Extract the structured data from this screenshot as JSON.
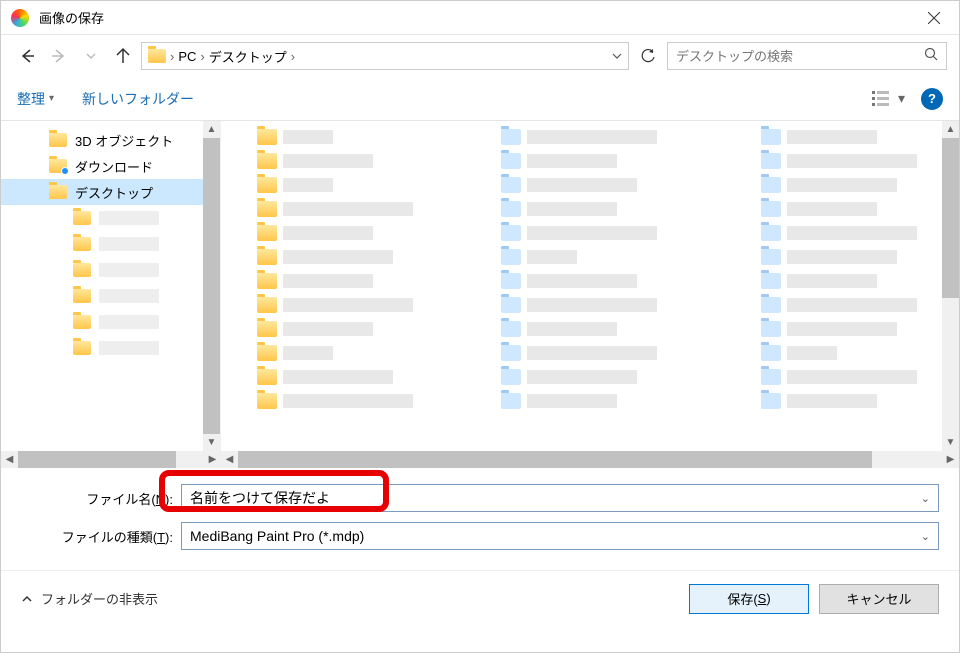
{
  "window": {
    "title": "画像の保存"
  },
  "nav": {
    "breadcrumb": {
      "root": "PC",
      "folder": "デスクトップ"
    },
    "search_placeholder": "デスクトップの検索"
  },
  "toolbar": {
    "organize": "整理",
    "new_folder": "新しいフォルダー"
  },
  "tree": {
    "items": [
      {
        "label": "3D オブジェクト"
      },
      {
        "label": "ダウンロード"
      },
      {
        "label": "デスクトップ"
      }
    ]
  },
  "form": {
    "filename_label_pre": "ファイル名(",
    "filename_label_key": "N",
    "filename_label_post": "):",
    "filename_value": "名前をつけて保存だよ",
    "filetype_label_pre": "ファイルの種類(",
    "filetype_label_key": "T",
    "filetype_label_post": "):",
    "filetype_value": "MediBang Paint Pro (*.mdp)"
  },
  "bottom": {
    "hide_folders": "フォルダーの非表示",
    "save_pre": "保存(",
    "save_key": "S",
    "save_post": ")",
    "cancel": "キャンセル"
  }
}
